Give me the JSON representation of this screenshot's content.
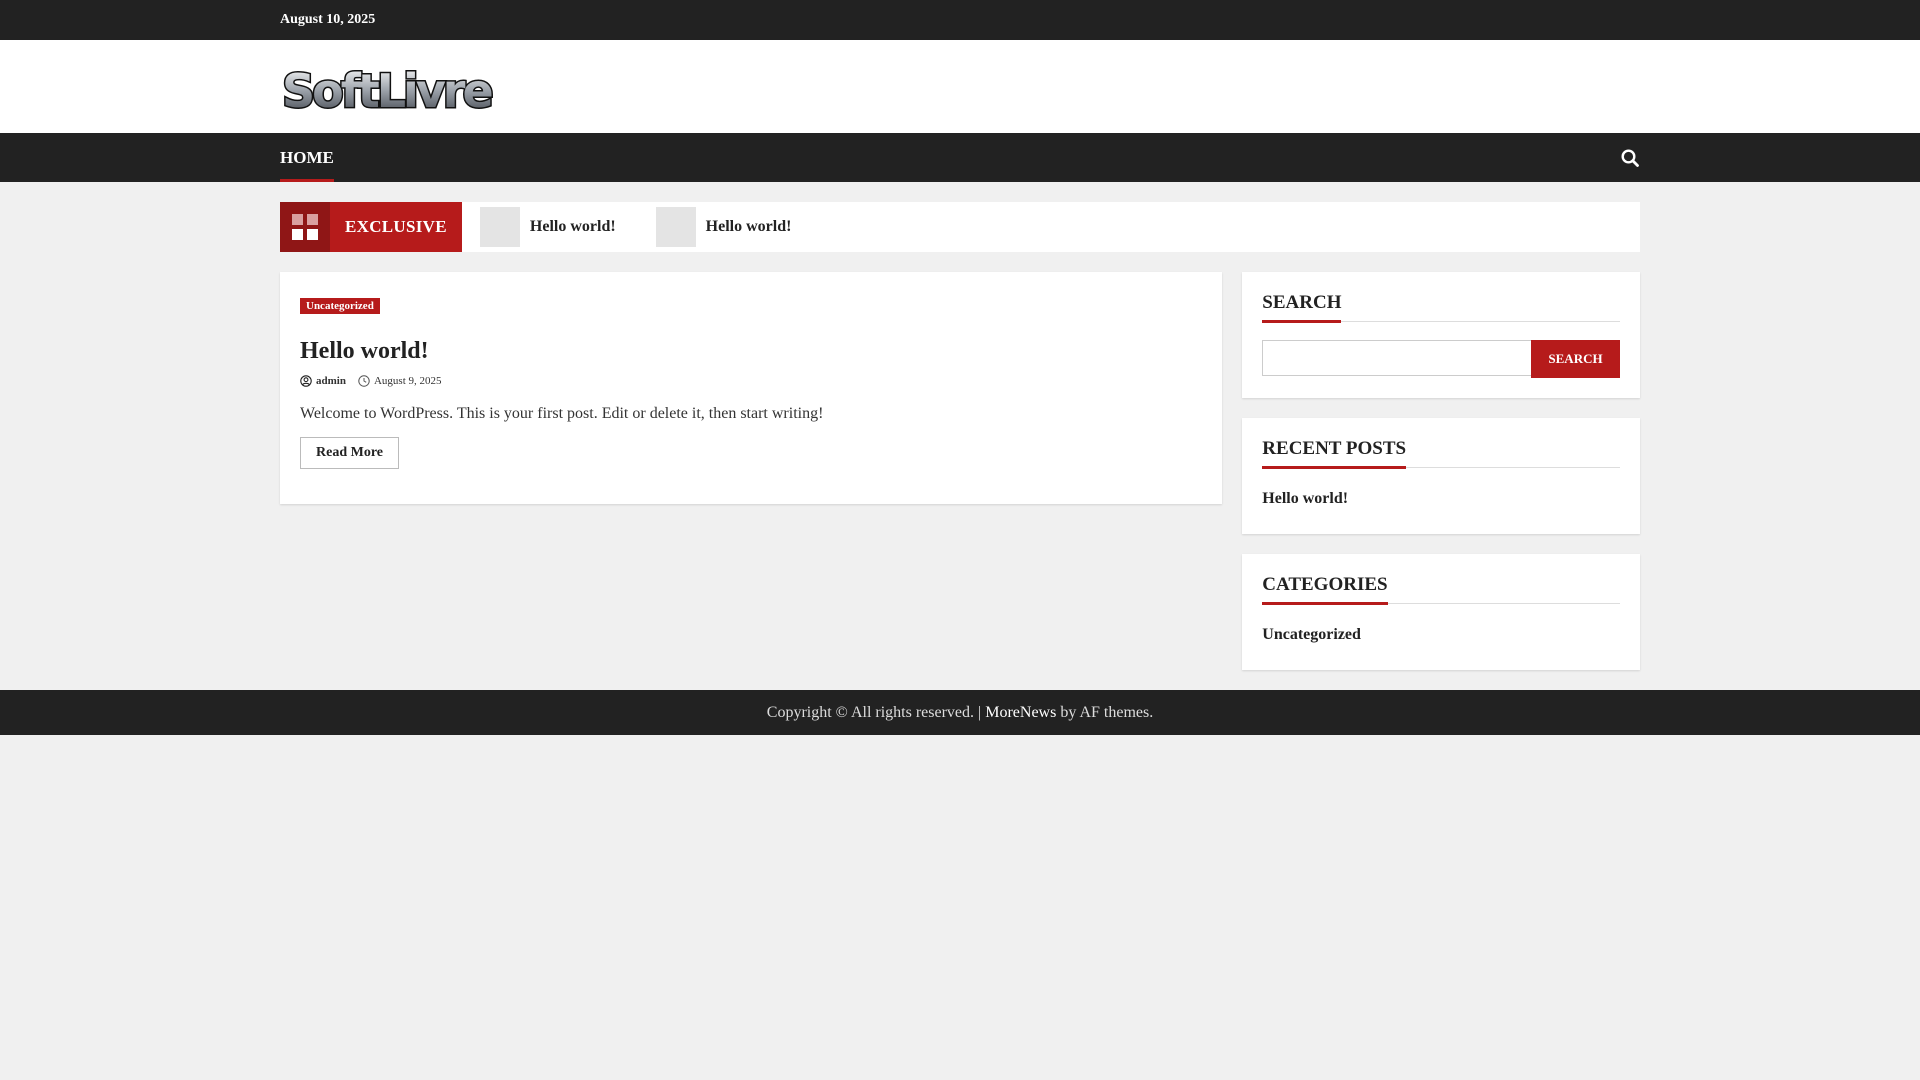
{
  "topbar": {
    "date": "August 10, 2025"
  },
  "brand": {
    "logo_text": "SoftLivre"
  },
  "nav": {
    "home_label": "HOME"
  },
  "ticker": {
    "label": "EXCLUSIVE",
    "items": [
      {
        "title": "Hello world!"
      },
      {
        "title": "Hello world!"
      }
    ]
  },
  "post": {
    "category": "Uncategorized",
    "title": "Hello world!",
    "author": "admin",
    "date": "August 9, 2025",
    "excerpt": "Welcome to WordPress. This is your first post. Edit or delete it, then start writing!",
    "read_more": "Read More"
  },
  "sidebar": {
    "search": {
      "title": "SEARCH",
      "button": "SEARCH",
      "value": ""
    },
    "recent": {
      "title": "RECENT POSTS",
      "items": [
        "Hello world!"
      ]
    },
    "categories": {
      "title": "CATEGORIES",
      "items": [
        "Uncategorized"
      ]
    }
  },
  "footer": {
    "copyright": "Copyright © All rights reserved. | ",
    "theme_name": "MoreNews",
    "by_text": " by AF themes."
  },
  "colors": {
    "accent": "#b61b1b",
    "dark": "#222222",
    "background": "#f0f0f0"
  }
}
